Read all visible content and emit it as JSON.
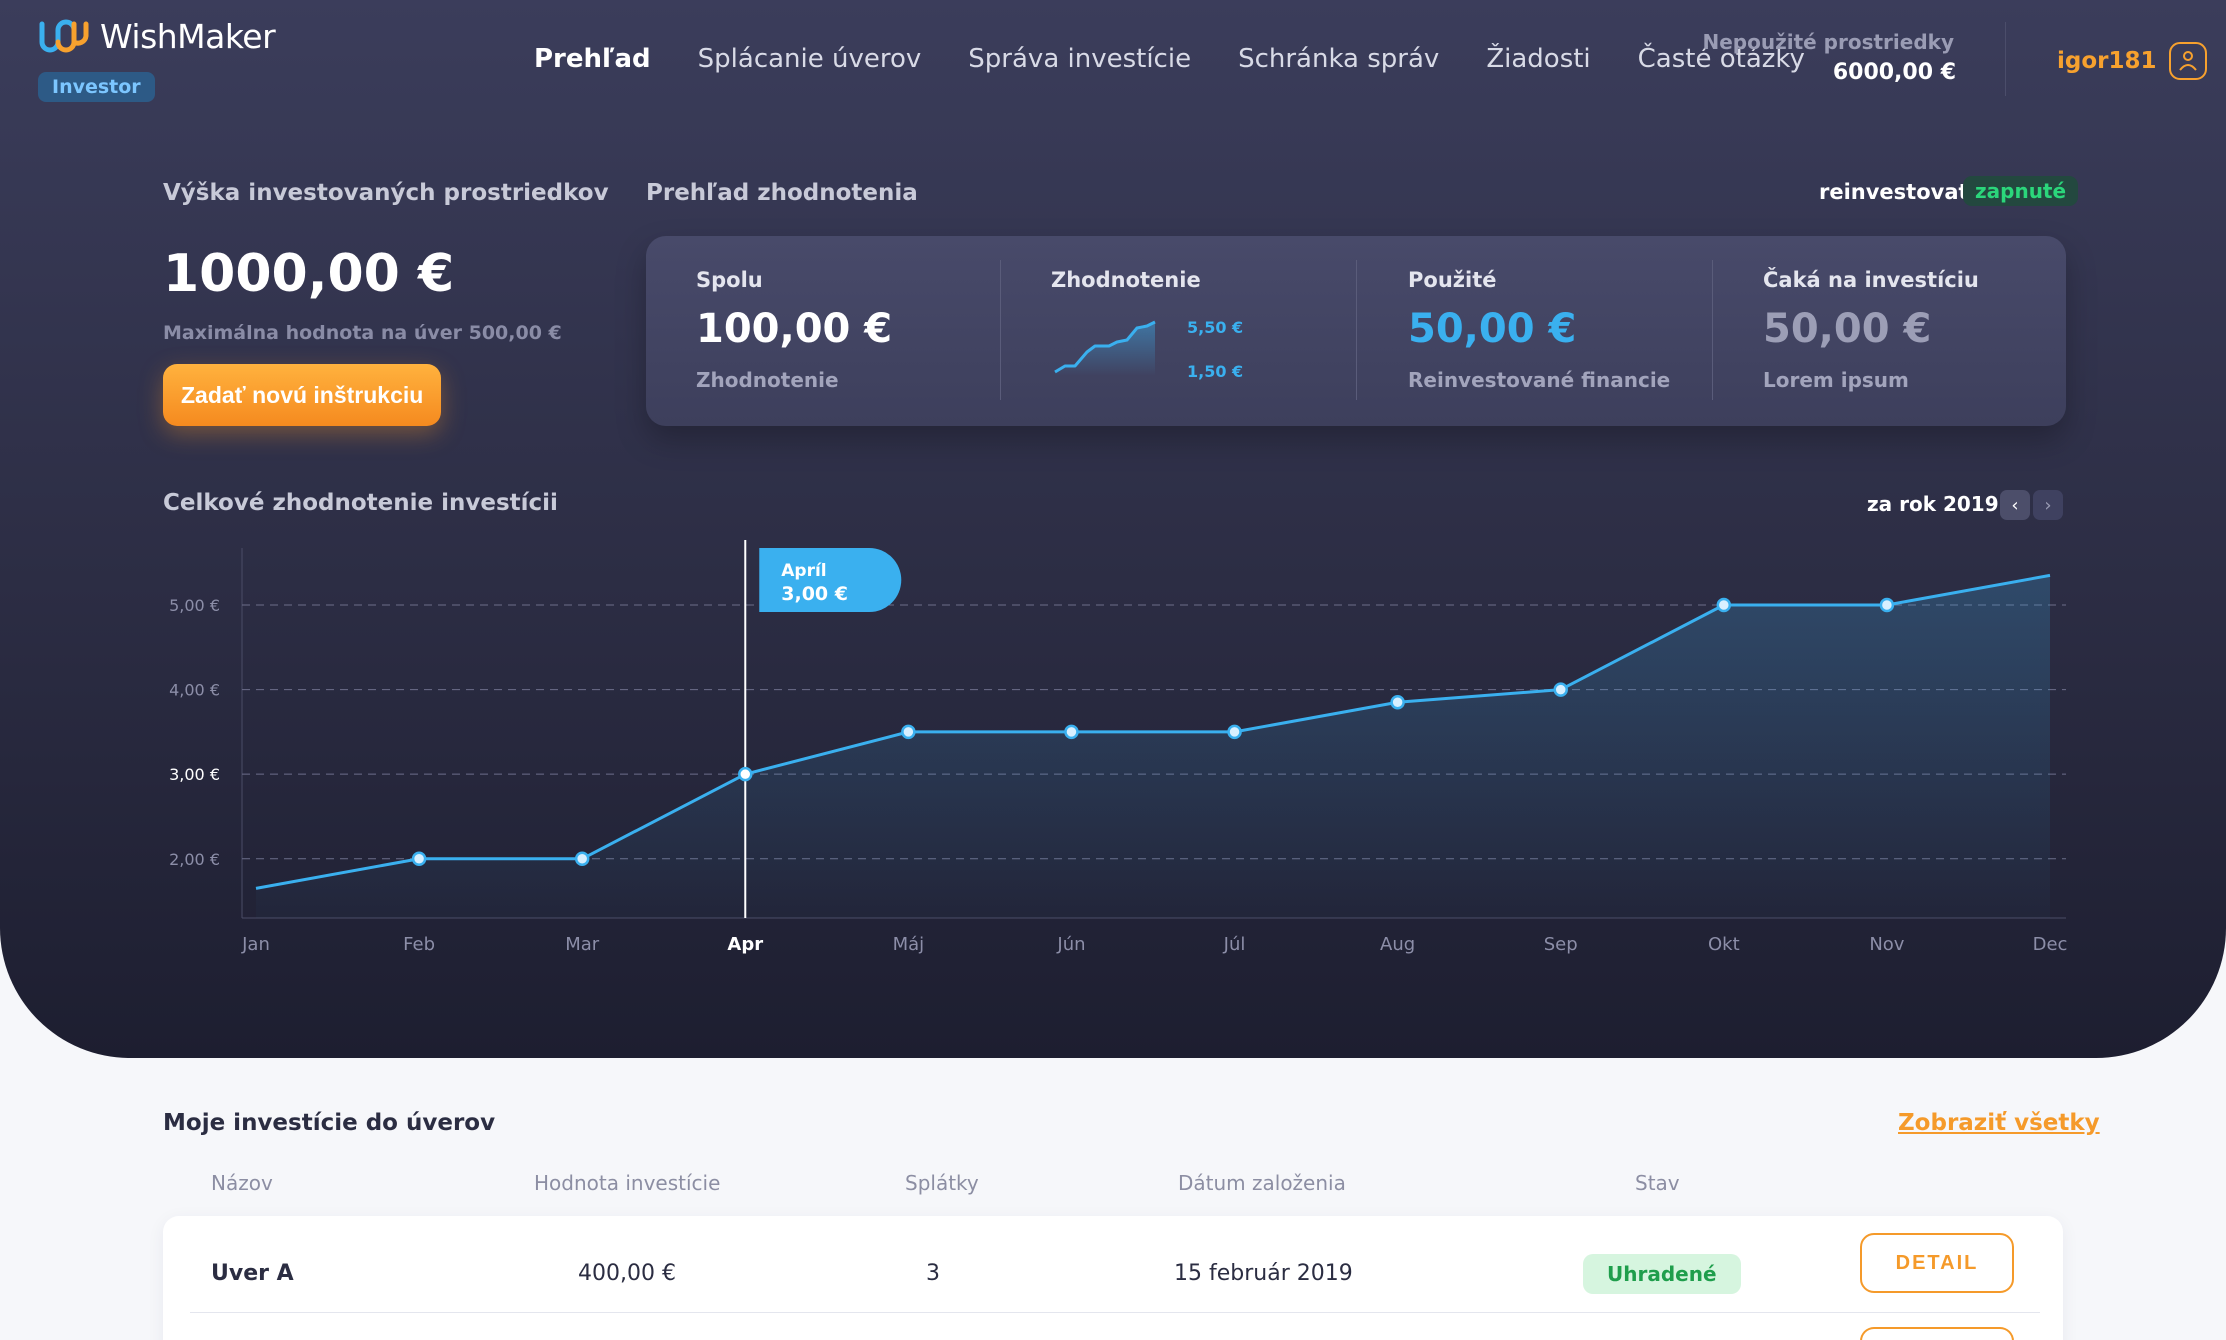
{
  "brand": {
    "name": "WishMaker",
    "role": "Investor"
  },
  "nav": {
    "items": [
      "Prehľad",
      "Splácanie úverov",
      "Správa investície",
      "Schránka správ",
      "Žiadosti",
      "Časté otázky"
    ],
    "active": 0
  },
  "funds": {
    "label": "Nepoužité prostriedky",
    "value": "6000,00 €"
  },
  "user": {
    "name": "igor181"
  },
  "invested": {
    "title": "Výška investovaných prostriedkov",
    "amount": "1000,00 €",
    "note": "Maximálna hodnota na úver 500,00 €",
    "cta": "Zadať novú inštrukciu"
  },
  "overview": {
    "title": "Prehľad zhodnotenia",
    "reinvest_label": "reinvestovať",
    "reinvest_state": "zapnuté",
    "stats": [
      {
        "label": "Spolu",
        "value": "100,00 €",
        "sub": "Zhodnotenie"
      },
      {
        "label": "Zhodnotenie",
        "spark_max": "5,50 €",
        "spark_min": "1,50 €"
      },
      {
        "label": "Použité",
        "value": "50,00 €",
        "sub": "Reinvestované financie"
      },
      {
        "label": "Čaká na investíciu",
        "value": "50,00 €",
        "sub": "Lorem ipsum"
      }
    ]
  },
  "chart_section": {
    "title": "Celkové zhodnotenie investícii",
    "period": "za rok 2019"
  },
  "chart_data": {
    "type": "area",
    "title": "Celkové zhodnotenie investícii",
    "categories": [
      "Jan",
      "Feb",
      "Mar",
      "Apr",
      "Máj",
      "Jún",
      "Júl",
      "Aug",
      "Sep",
      "Okt",
      "Nov",
      "Dec"
    ],
    "values": [
      1.65,
      2.0,
      2.0,
      3.0,
      3.5,
      3.5,
      3.5,
      3.85,
      4.0,
      5.0,
      5.0,
      5.35
    ],
    "yticks": [
      "5,00 €",
      "4,00 €",
      "3,00 €",
      "2,00 €"
    ],
    "ytick_values": [
      5,
      4,
      3,
      2
    ],
    "ylim": [
      1.3,
      5.65
    ],
    "highlight_index": 3,
    "tooltip": {
      "label": "Apríl",
      "value": "3,00 €"
    },
    "colors": {
      "line": "#3ab0ef",
      "fill": "#3ab0ef"
    }
  },
  "investments": {
    "title": "Moje investície do úverov",
    "see_all": "Zobraziť všetky",
    "columns": [
      "Názov",
      "Hodnota investície",
      "Splátky",
      "Dátum založenia",
      "Stav"
    ],
    "rows": [
      {
        "name": "Uver A",
        "amount": "400,00 €",
        "installments": "3",
        "date": "15 február 2019",
        "status": "Uhradené",
        "action": "DETAIL"
      }
    ]
  }
}
